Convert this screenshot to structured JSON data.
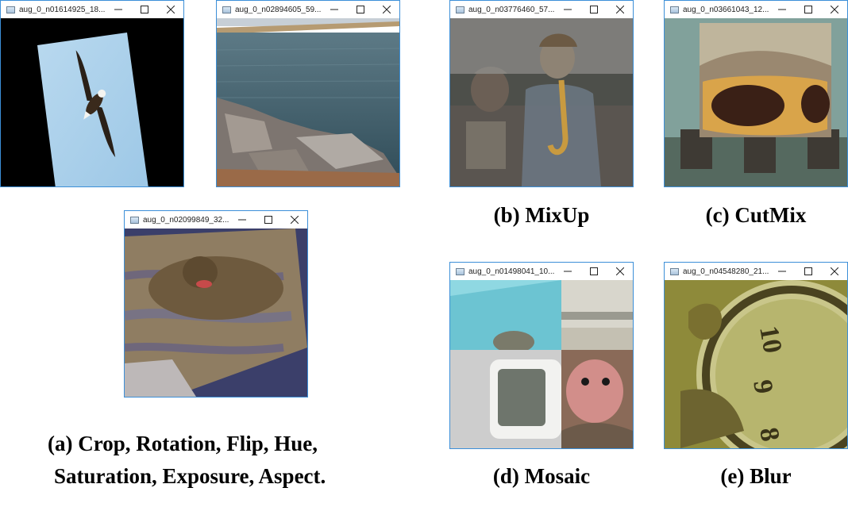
{
  "windows": {
    "w1": {
      "title": "aug_0_n01614925_18..."
    },
    "w2": {
      "title": "aug_0_n02894605_59..."
    },
    "w3": {
      "title": "aug_0_n02099849_32..."
    },
    "w4": {
      "title": "aug_0_n03776460_57..."
    },
    "w5": {
      "title": "aug_0_n03661043_12..."
    },
    "w6": {
      "title": "aug_0_n01498041_10..."
    },
    "w7": {
      "title": "aug_0_n04548280_21..."
    }
  },
  "captions": {
    "a_line1": "(a)  Crop, Rotation, Flip, Hue,",
    "a_line2": "Saturation,  Exposure, Aspect.",
    "b": "(b) MixUp",
    "c": "(c) CutMix",
    "d": "(d) Mosaic",
    "e": "(e) Blur"
  },
  "icons": {
    "app": "app-window-icon",
    "minimize": "minimize-icon",
    "maximize": "maximize-icon",
    "close": "close-icon"
  },
  "colors": {
    "window_border": "#3c8fd8",
    "caption_text": "#000000"
  }
}
